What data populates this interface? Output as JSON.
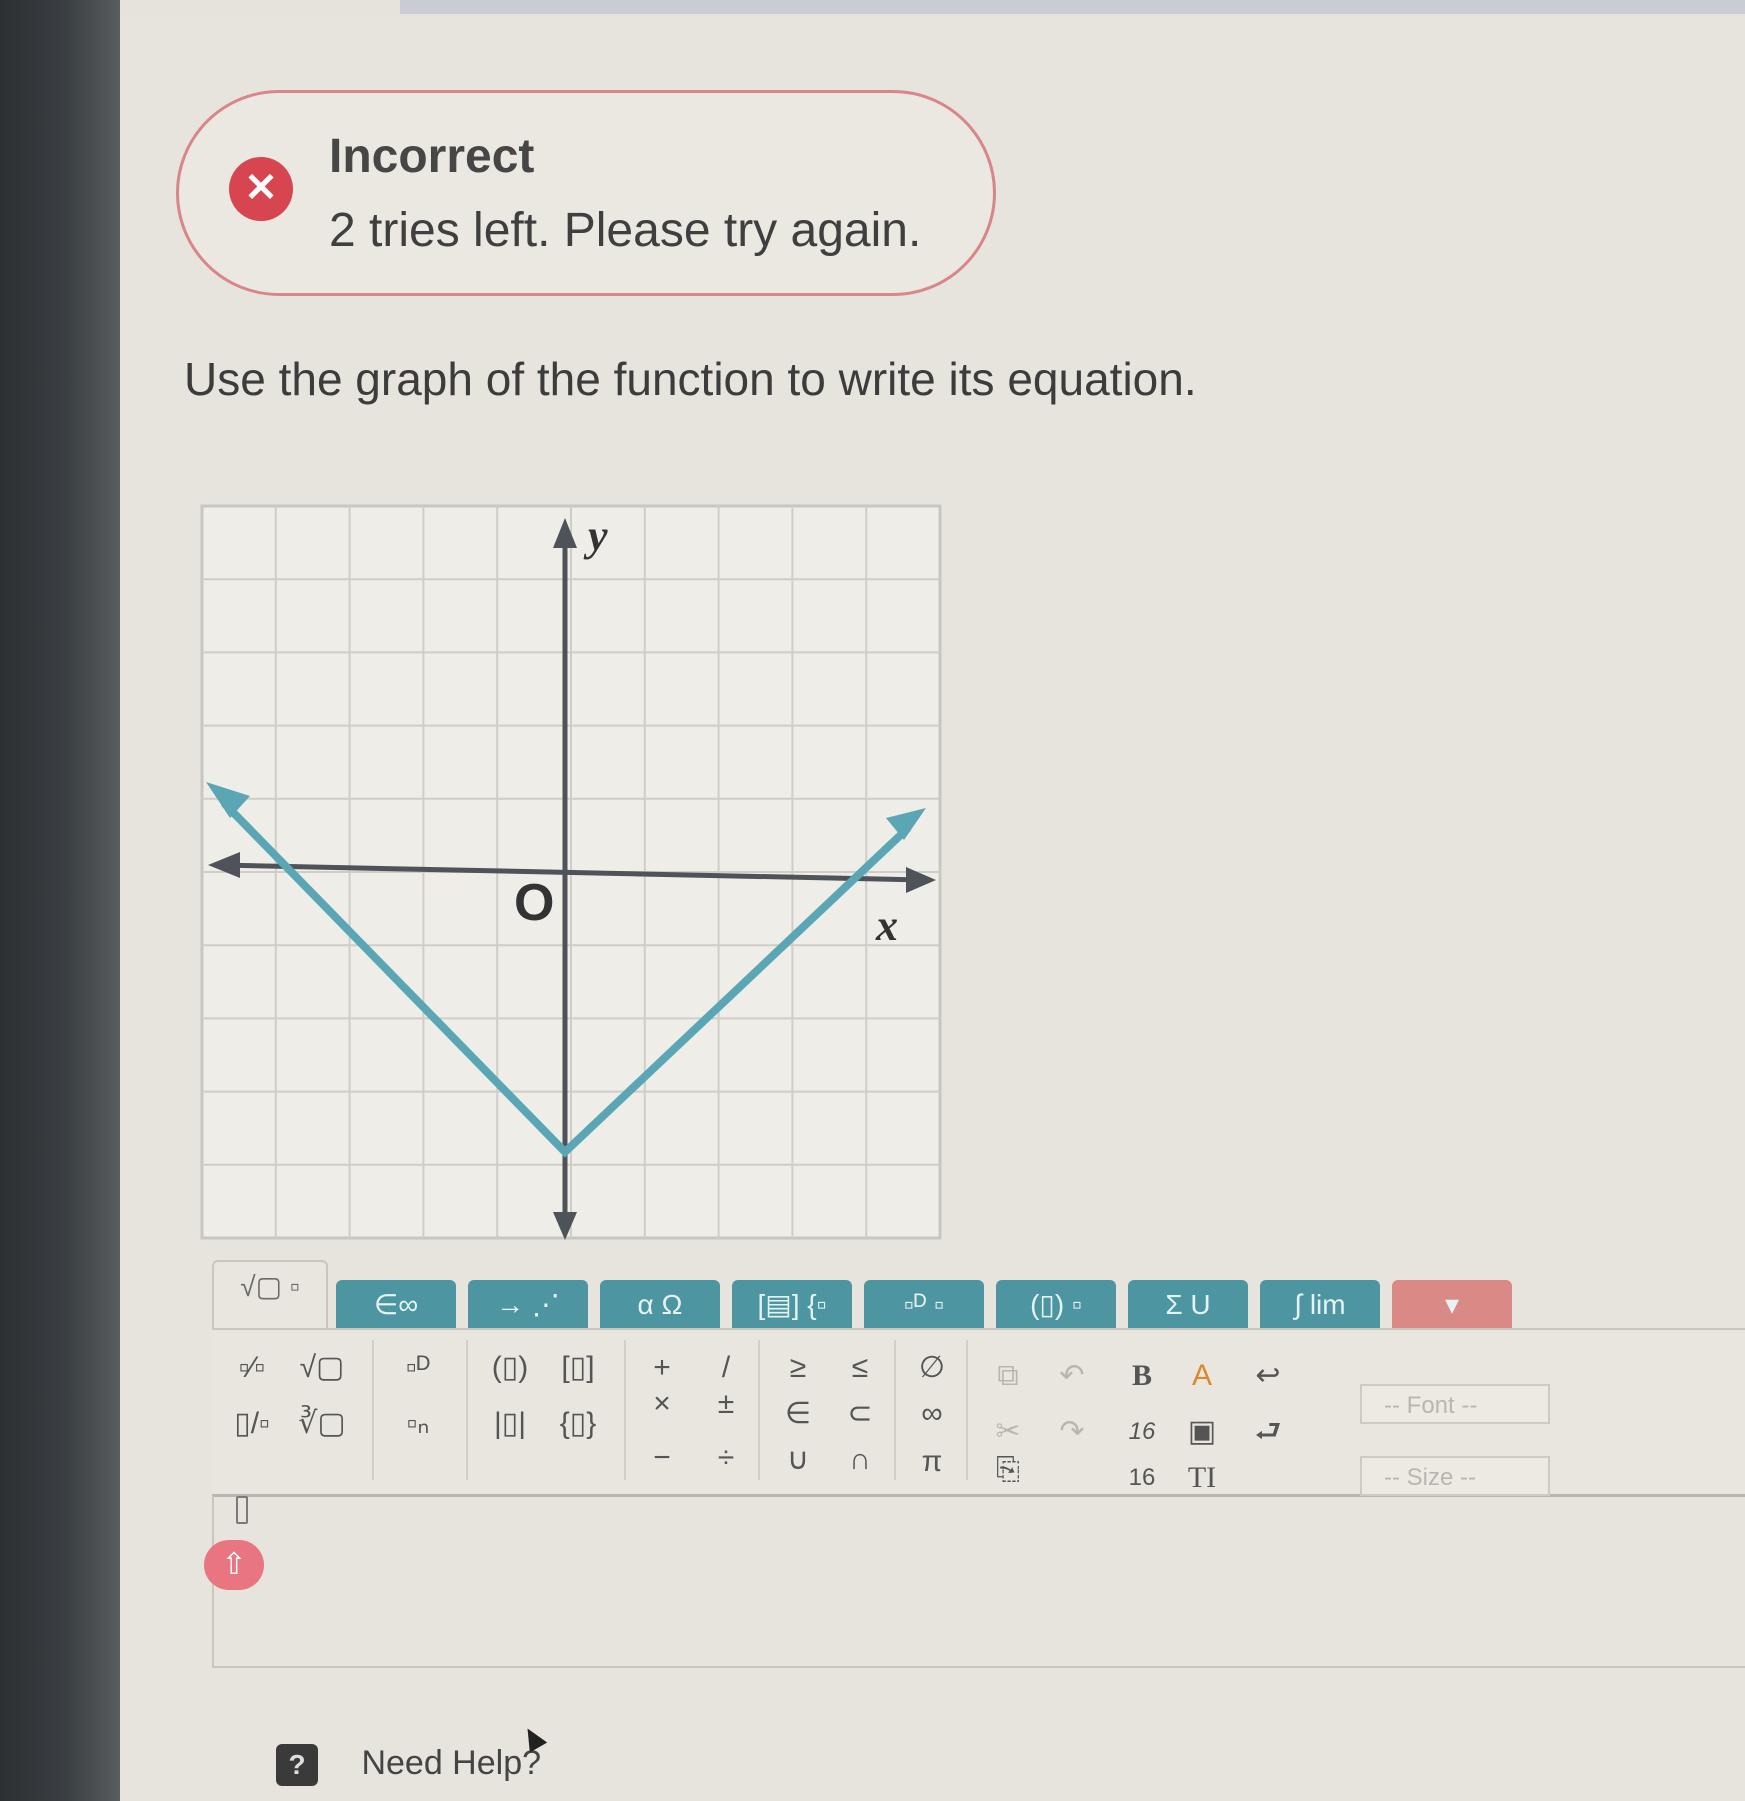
{
  "feedback": {
    "title": "Incorrect",
    "message": "2 tries left. Please try again.",
    "status_color": "#d64550"
  },
  "question": {
    "prompt": "Use the graph of the function to write its equation."
  },
  "graph": {
    "x_axis_label": "x",
    "y_axis_label": "y",
    "origin_label": "O",
    "grid_columns": 10,
    "grid_rows": 10,
    "curve_color": "#5aa6b5"
  },
  "tabs": [
    {
      "label": "√▢ ▫",
      "active": true
    },
    {
      "label": "∈∞"
    },
    {
      "label": "→ ⋰"
    },
    {
      "label": "α Ω"
    },
    {
      "label": "[▤] {▫"
    },
    {
      "label": "▫ᴰ ▫"
    },
    {
      "label": "(▯) ▫"
    },
    {
      "label": "Σ U"
    },
    {
      "label": "∫ lim"
    },
    {
      "label": "▾"
    }
  ],
  "palette": {
    "row1": [
      "▫⁄▫",
      "√▢",
      "▫ᴰ",
      "(▯)",
      "[▯]",
      "+",
      "/",
      "≥",
      "≤",
      "∅"
    ],
    "row2": [
      "▯/▫",
      "∛▢",
      "▫ₙ",
      "|▯|",
      "{▯}",
      "×",
      "±",
      "∈",
      "⊂",
      "∞"
    ],
    "row3": [
      "−",
      "÷",
      "∪",
      "∩",
      "π"
    ],
    "format": {
      "bold": "B",
      "size_a": "16",
      "size_b": "16",
      "tt": "TI"
    },
    "font_select": "-- Font --",
    "size_select": "-- Size --"
  },
  "help": {
    "icon": "?",
    "label": "Need Help?"
  }
}
